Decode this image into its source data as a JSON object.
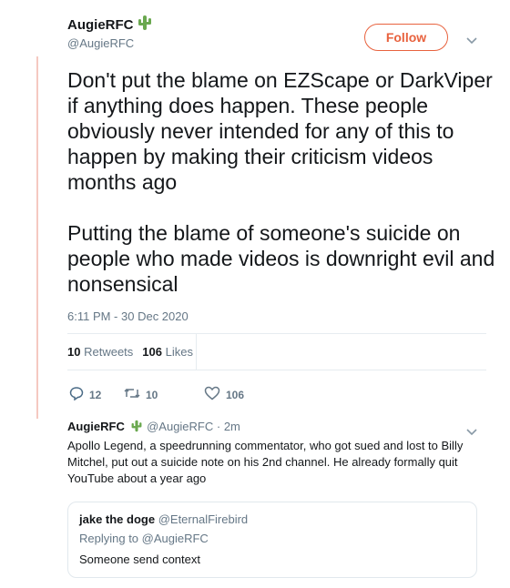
{
  "tweet": {
    "display_name": "AugieRFC",
    "handle": "@AugieRFC",
    "follow_label": "Follow",
    "text": "Don't put the blame on EZScape or DarkViper if anything does happen. These people obviously never intended for any of this to happen by making their criticism videos months ago\n\nPutting the blame of someone's suicide on people who made videos is downright evil and nonsensical",
    "timestamp": "6:11 PM - 30 Dec 2020",
    "retweets_count": "10",
    "retweets_label": "Retweets",
    "likes_count": "106",
    "likes_label": "Likes",
    "actions": {
      "reply_count": "12",
      "retweet_count": "10",
      "like_count": "106"
    }
  },
  "reply": {
    "display_name": "AugieRFC",
    "handle": "@AugieRFC",
    "time": "· 2m",
    "text": "Apollo Legend, a speedrunning commentator, who got sued and lost to Billy Mitchel, put out a suicide note on his 2nd channel. He already formally quit YouTube about a year ago"
  },
  "quoted": {
    "display_name": "jake the doge",
    "handle": "@EternalFirebird",
    "replying_to": "Replying to @AugieRFC",
    "text": "Someone send context"
  },
  "icons": [
    "cactus-icon",
    "chevron-down-icon",
    "reply-icon",
    "retweet-icon",
    "heart-icon"
  ],
  "colors": {
    "accent": "#e8623e",
    "muted": "#657786",
    "thread_line": "#f5c9c1"
  }
}
